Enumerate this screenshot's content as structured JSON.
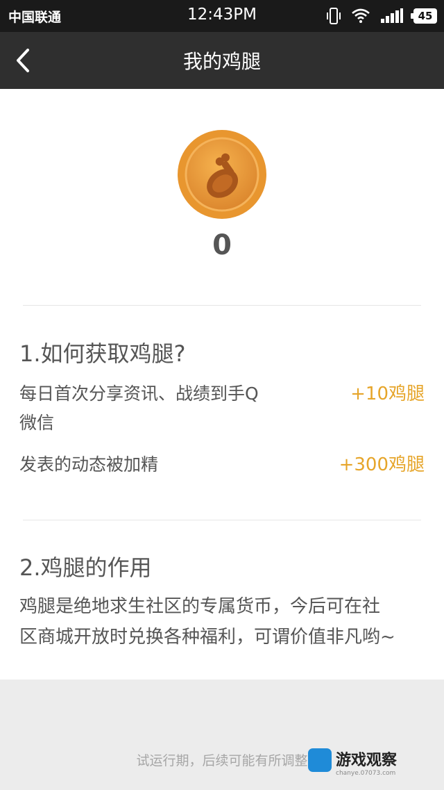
{
  "status_bar": {
    "carrier": "中国联通",
    "time": "12:43PM",
    "battery": "45"
  },
  "nav": {
    "title": "我的鸡腿",
    "back_icon": "chevron-left-icon"
  },
  "summary": {
    "coin_icon": "drumstick-coin-icon",
    "balance": "0"
  },
  "how_to_get": {
    "title": "1.如何获取鸡腿?",
    "rules": [
      {
        "text_line1": "每日首次分享资讯、战绩到手Q",
        "text_line2": "微信",
        "reward": "+10鸡腿"
      },
      {
        "text_line1": "发表的动态被加精",
        "text_line2": "",
        "reward": "+300鸡腿"
      }
    ]
  },
  "usage": {
    "title": "2.鸡腿的作用",
    "line1": "鸡腿是绝地求生社区的专属货币，今后可在社",
    "line2": "区商城开放时兑换各种福利，可谓价值非凡哟~"
  },
  "footer": {
    "note": "试运行期，后续可能有所调整"
  },
  "watermark": {
    "brand": "游戏观察",
    "url": "chanye.07073.com"
  },
  "colors": {
    "accent": "#e6a52a",
    "nav_bg": "#2f2f2f",
    "status_bg": "#1a1a1a"
  }
}
